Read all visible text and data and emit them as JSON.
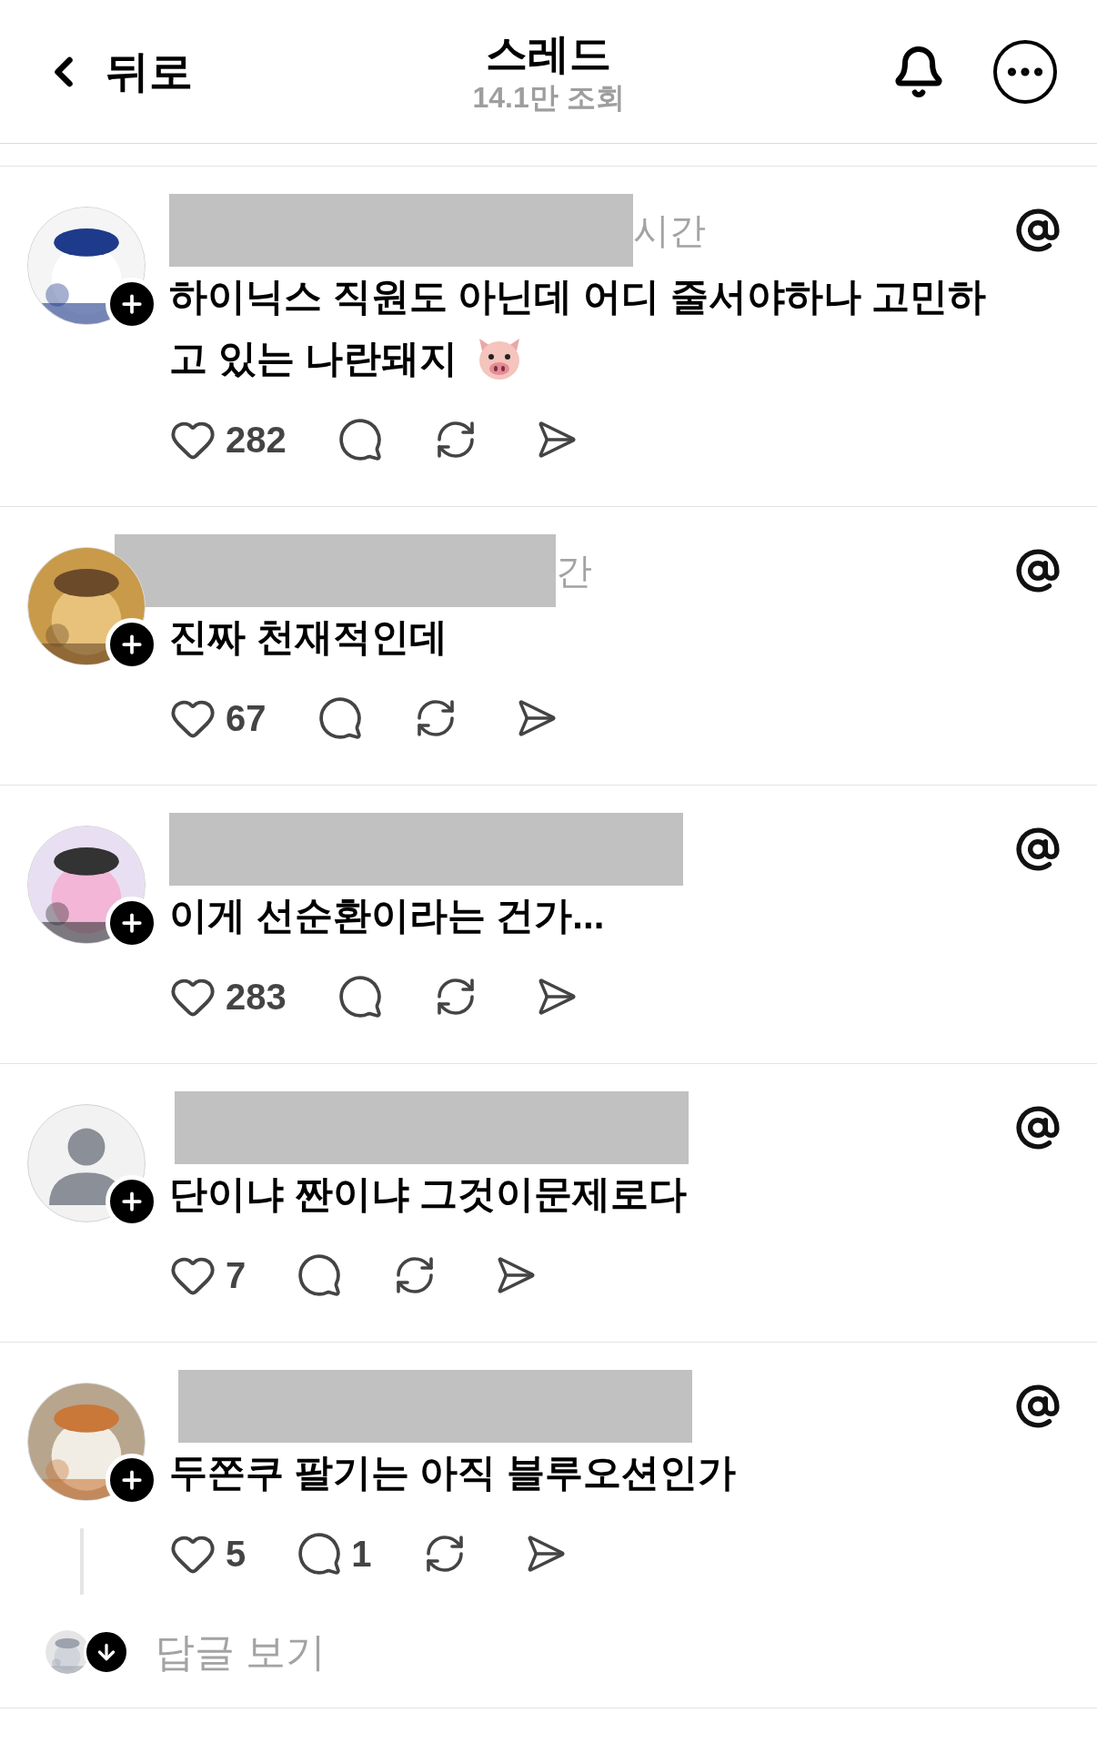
{
  "header": {
    "back": "뒤로",
    "title": "스레드",
    "views": "14.1만 조회"
  },
  "posts": [
    {
      "avatar": {
        "kind": "picture"
      },
      "author": {
        "redacted": true
      },
      "time": "시간",
      "lines": [
        "하이닉스 직원도 아닌데 어디 줄서야하나 고민하",
        "고 있는 나란돼지"
      ],
      "pig": true,
      "likes": "282"
    },
    {
      "avatar": {
        "kind": "picture"
      },
      "author": {
        "redacted": true
      },
      "time": "간",
      "lines": [
        "진짜 천재적인데"
      ],
      "pig": false,
      "likes": "67"
    },
    {
      "avatar": {
        "kind": "picture"
      },
      "author": {
        "redacted": true
      },
      "lines": [
        "이게 선순환이라는 건가..."
      ],
      "pig": false,
      "likes": "283"
    },
    {
      "avatar": {
        "kind": "default"
      },
      "author": {
        "redacted": true
      },
      "lines": [
        "단이냐 짠이냐 그것이문제로다"
      ],
      "pig": false,
      "likes": "7"
    },
    {
      "avatar": {
        "kind": "picture"
      },
      "author": {
        "redacted": true
      },
      "lines": [
        "두쫀쿠 팔기는 아직 블루오션인가"
      ],
      "pig": false,
      "likes": "5",
      "replies": "1",
      "view_replies": "답글 보기"
    }
  ]
}
